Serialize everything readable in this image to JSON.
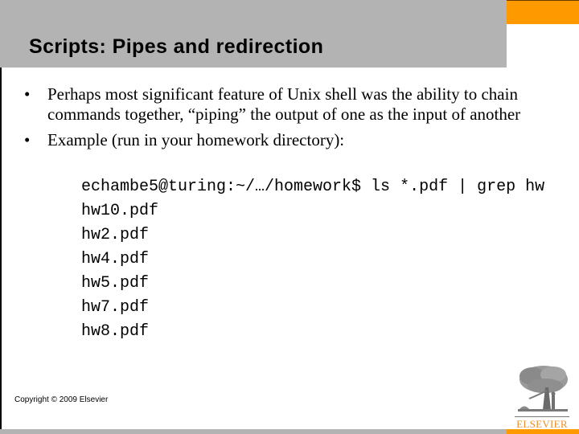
{
  "slide": {
    "title": "Scripts: Pipes and redirection",
    "bullets": [
      {
        "marker": "•",
        "text": "Perhaps most significant feature of Unix shell was the ability to chain commands together, “piping” the output of one as the input of another"
      },
      {
        "marker": "•",
        "text": "Example (run in your homework directory):"
      }
    ],
    "code_lines": [
      "echambe5@turing:~/…/homework$ ls *.pdf | grep hw",
      "hw10.pdf",
      "hw2.pdf",
      "hw4.pdf",
      "hw5.pdf",
      "hw7.pdf",
      "hw8.pdf"
    ],
    "footer": {
      "copyright": "Copyright © 2009 Elsevier",
      "logo_text": "ELSEVIER",
      "logo_icon": "elsevier-tree-icon"
    }
  },
  "colors": {
    "header_gray": "#b3b3b4",
    "accent_orange": "#ff9900",
    "logo_orange": "#e8902a"
  }
}
